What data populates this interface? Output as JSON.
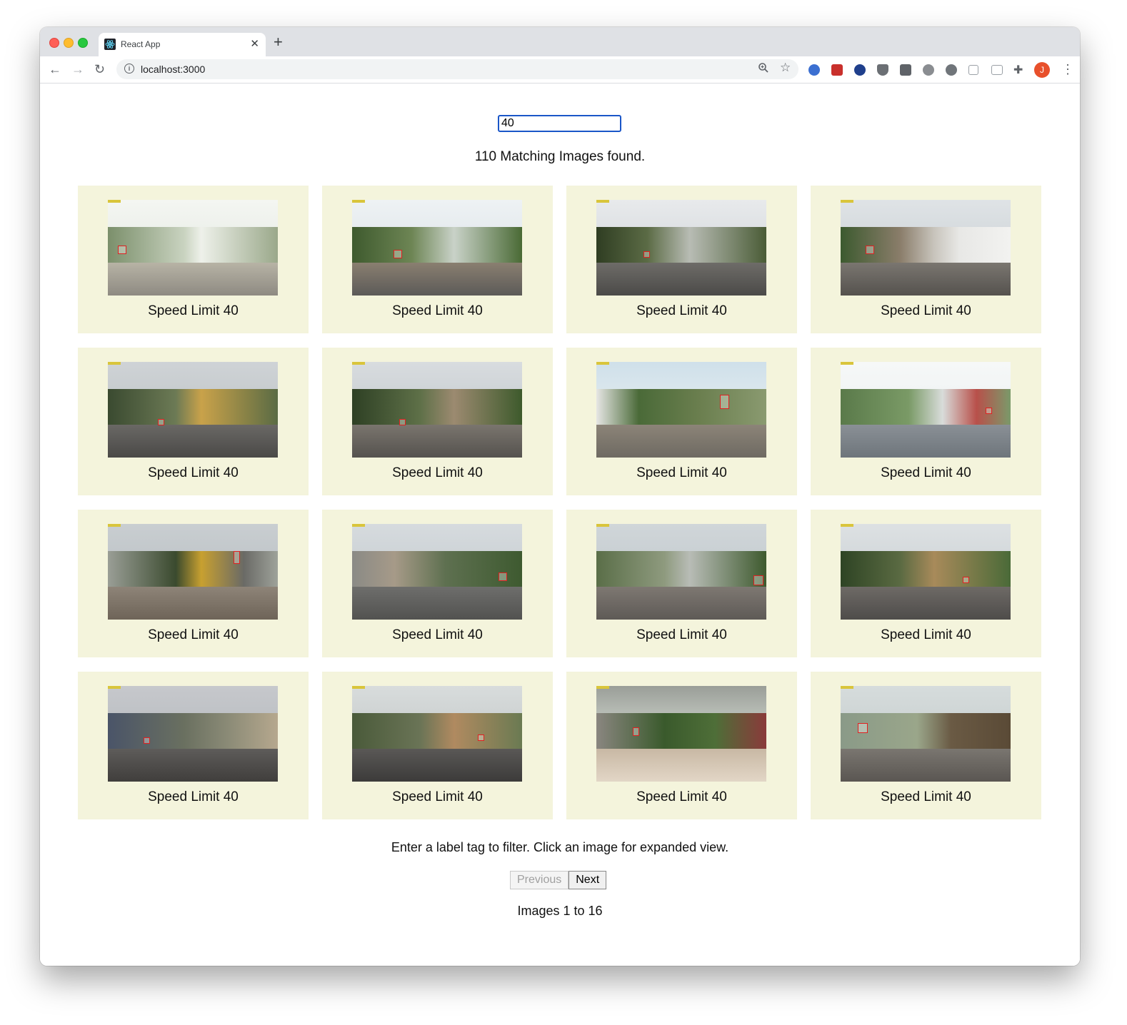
{
  "browser": {
    "tab_title": "React App",
    "url": "localhost:3000",
    "profile_initial": "J"
  },
  "search": {
    "value": "40"
  },
  "results": {
    "count_text": "110 Matching Images found."
  },
  "cards": [
    {
      "label": "Speed Limit 40"
    },
    {
      "label": "Speed Limit 40"
    },
    {
      "label": "Speed Limit 40"
    },
    {
      "label": "Speed Limit 40"
    },
    {
      "label": "Speed Limit 40"
    },
    {
      "label": "Speed Limit 40"
    },
    {
      "label": "Speed Limit 40"
    },
    {
      "label": "Speed Limit 40"
    },
    {
      "label": "Speed Limit 40"
    },
    {
      "label": "Speed Limit 40"
    },
    {
      "label": "Speed Limit 40"
    },
    {
      "label": "Speed Limit 40"
    },
    {
      "label": "Speed Limit 40"
    },
    {
      "label": "Speed Limit 40"
    },
    {
      "label": "Speed Limit 40"
    },
    {
      "label": "Speed Limit 40"
    }
  ],
  "footer": {
    "hint": "Enter a label tag to filter. Click an image for expanded view.",
    "previous_label": "Previous",
    "next_label": "Next",
    "range_text": "Images 1 to 16"
  },
  "colors": {
    "card_background": "#f4f4dc",
    "input_focus": "#1a56c8",
    "bbox": "#e02020"
  }
}
